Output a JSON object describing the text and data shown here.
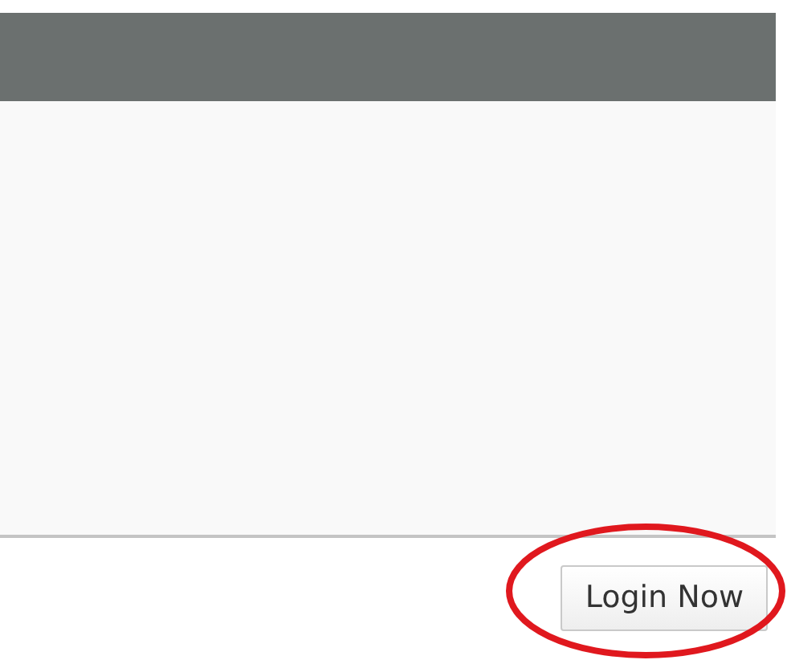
{
  "login_button": {
    "label": "Login Now",
    "highlighted": true
  }
}
